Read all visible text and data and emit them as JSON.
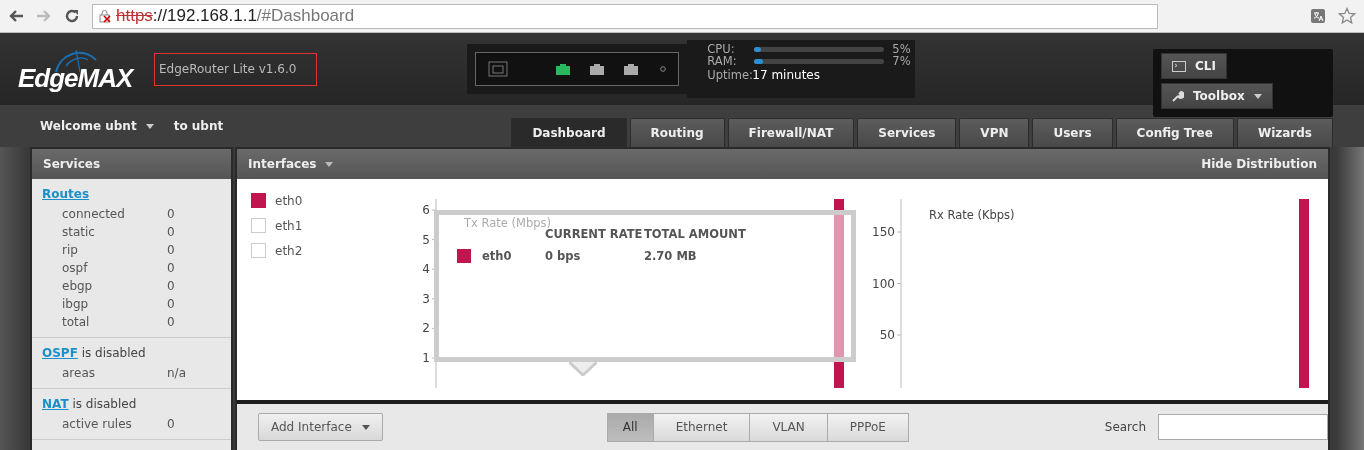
{
  "browser": {
    "url_scheme": "https",
    "url_host": "://192.168.1.1",
    "url_path": "/#Dashboard"
  },
  "header": {
    "logo": "EdgeMAX",
    "device": "EdgeRouter Lite v1.6.0",
    "ports": [
      {
        "up": true
      },
      {
        "up": false
      },
      {
        "up": false
      }
    ],
    "stats": [
      {
        "label": "CPU:",
        "level": 0.05,
        "reading": "5%"
      },
      {
        "label": "RAM:",
        "level": 0.07,
        "reading": "7%"
      }
    ],
    "uptime_label": "Uptime:",
    "uptime": "17 minutes",
    "cli": "CLI",
    "toolbox": "Toolbox"
  },
  "nav": {
    "welcome": "Welcome ubnt",
    "to_user": "to ubnt",
    "tabs": [
      {
        "label": "Dashboard",
        "selected": true
      },
      {
        "label": "Routing",
        "selected": false
      },
      {
        "label": "Firewall/NAT",
        "selected": false
      },
      {
        "label": "Services",
        "selected": false
      },
      {
        "label": "VPN",
        "selected": false
      },
      {
        "label": "Users",
        "selected": false
      },
      {
        "label": "Config Tree",
        "selected": false
      },
      {
        "label": "Wizards",
        "selected": false
      }
    ]
  },
  "sidebar": {
    "title": "Services",
    "sections": [
      {
        "link": "Routes",
        "rows": [
          {
            "name": "connected",
            "value": "0"
          },
          {
            "name": "static",
            "value": "0"
          },
          {
            "name": "rip",
            "value": "0"
          },
          {
            "name": "ospf",
            "value": "0"
          },
          {
            "name": "ebgp",
            "value": "0"
          },
          {
            "name": "ibgp",
            "value": "0"
          },
          {
            "name": "total",
            "value": "0"
          }
        ]
      },
      {
        "link": "OSPF",
        "suffix": " is disabled",
        "rows": [
          {
            "name": "areas",
            "value": "n/a"
          }
        ]
      },
      {
        "link": "NAT",
        "suffix": " is disabled",
        "rows": [
          {
            "name": "active rules",
            "value": "0"
          }
        ]
      }
    ]
  },
  "interfaces": {
    "title": "Interfaces",
    "hide_link": "Hide Distribution",
    "legend": [
      {
        "name": "eth0",
        "checked": true
      },
      {
        "name": "eth1",
        "checked": false
      },
      {
        "name": "eth2",
        "checked": false
      }
    ],
    "tx_chart": {
      "title": "Tx Rate (Mbps)",
      "y_ticks": [
        "6",
        "5",
        "4",
        "3",
        "2",
        "1"
      ]
    },
    "rx_chart": {
      "title": "Rx Rate (Kbps)",
      "y_ticks": [
        "150",
        "100",
        "50"
      ]
    },
    "tooltip": {
      "columns": [
        "CURRENT RATE",
        "TOTAL AMOUNT"
      ],
      "rows": [
        {
          "name": "eth0",
          "color": "#c0154f",
          "rate": "0 bps",
          "total": "2.70 MB"
        }
      ]
    },
    "add_button": "Add Interface",
    "filters": [
      {
        "label": "All",
        "selected": true
      },
      {
        "label": "Ethernet",
        "selected": false
      },
      {
        "label": "VLAN",
        "selected": false
      },
      {
        "label": "PPPoE",
        "selected": false
      }
    ],
    "search_label": "Search"
  }
}
